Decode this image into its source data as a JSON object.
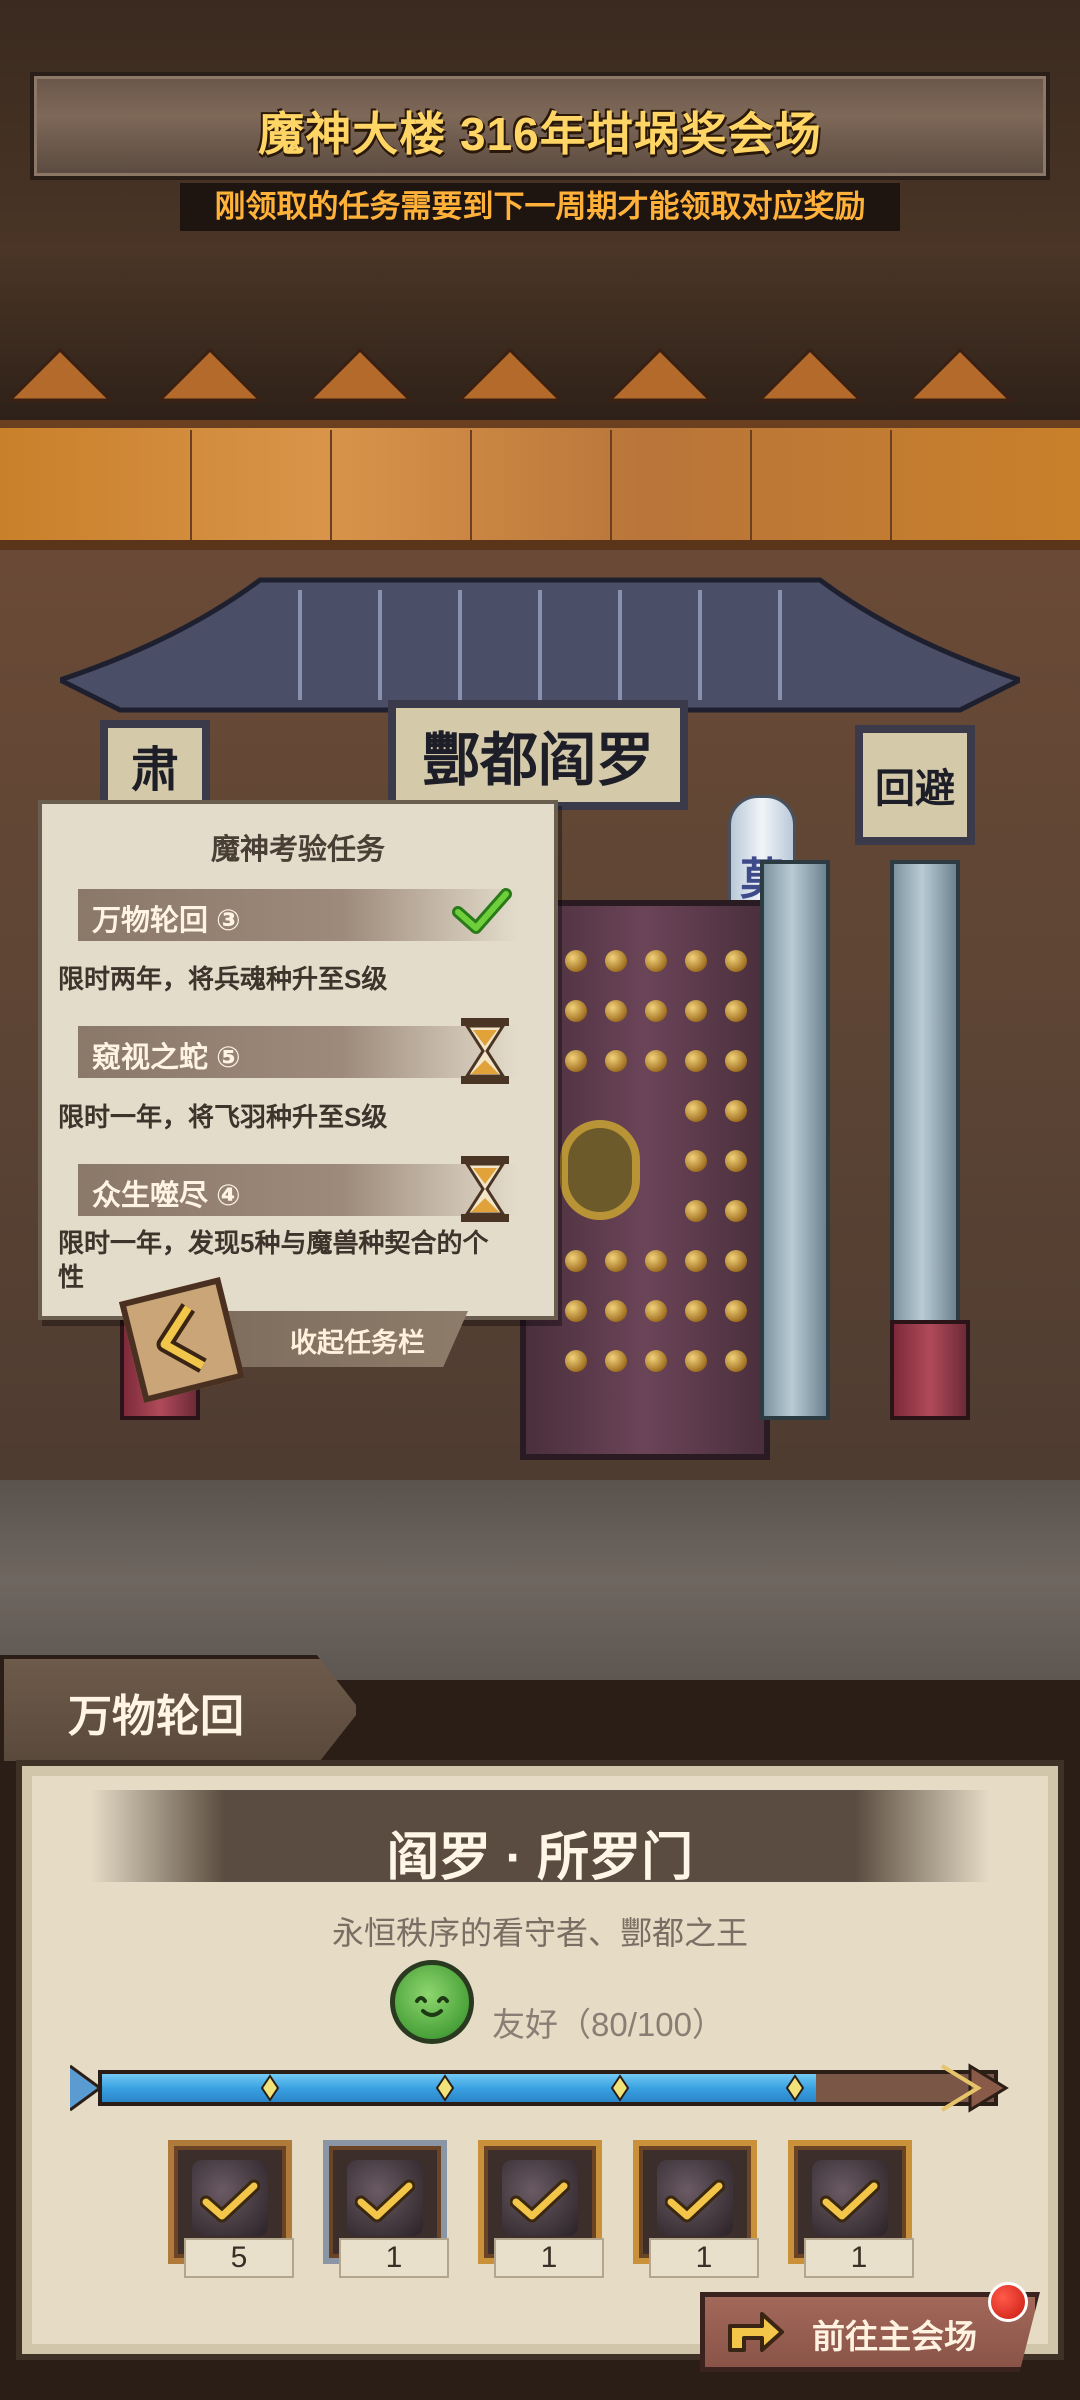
{
  "header": {
    "title": "魔神大楼 316年坩埚奖会场",
    "notice": "刚领取的任务需要到下一周期才能领取对应奖励"
  },
  "scene": {
    "plaque_main": "酆都阎罗",
    "plaque_left": "肃",
    "plaque_right": "回避",
    "lantern": "莫"
  },
  "tasks": {
    "title": "魔神考验任务",
    "items": [
      {
        "name": "万物轮回 ③",
        "description": "限时两年，将兵魂种升至S级",
        "status": "complete",
        "status_icon": "check-icon"
      },
      {
        "name": "窥视之蛇 ⑤",
        "description": "限时一年，将飞羽种升至S级",
        "status": "pending",
        "status_icon": "hourglass-icon"
      },
      {
        "name": "众生噬尽 ④",
        "description": "限时一年，发现5种与魔兽种契合的个性",
        "status": "pending",
        "status_icon": "hourglass-icon"
      }
    ],
    "collapse_label": "收起任务栏"
  },
  "detail": {
    "tab_label": "万物轮回",
    "character_name": "阎罗 · 所罗门",
    "character_subtitle": "永恒秩序的看守者、酆都之王",
    "relation_label": "友好（80/100）",
    "relation_progress": 0.8,
    "colors": {
      "progress": "#3aa2e2",
      "accent": "#ffd666",
      "notice": "#ffb13a"
    },
    "rewards": [
      {
        "icon": "dark-crystal-icon",
        "count": "5",
        "claimed": true
      },
      {
        "icon": "scroll-icon",
        "count": "1",
        "claimed": true
      },
      {
        "icon": "book-icon",
        "count": "1",
        "claimed": true
      },
      {
        "icon": "ore-icon",
        "count": "1",
        "claimed": true
      },
      {
        "icon": "brush-icon",
        "count": "1",
        "claimed": true
      }
    ],
    "go_button_label": "前往主会场"
  }
}
